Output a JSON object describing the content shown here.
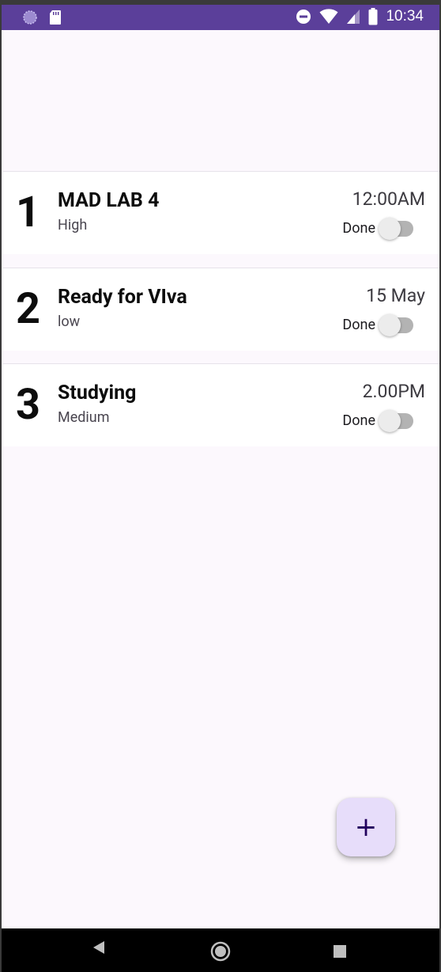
{
  "status_bar": {
    "time": "10:34",
    "background_color": "#5b3f9a",
    "left_icons": [
      "spinner-icon",
      "sd-card-icon"
    ],
    "right_icons": [
      "do-not-disturb-icon",
      "wifi-icon",
      "cell-signal-icon",
      "battery-icon"
    ]
  },
  "tasks": [
    {
      "number": "1",
      "title": "MAD LAB 4",
      "priority": "High",
      "time": "12:00AM",
      "done_label": "Done",
      "done": false
    },
    {
      "number": "2",
      "title": "Ready for VIva",
      "priority": "low",
      "time": "15 May",
      "done_label": "Done",
      "done": false
    },
    {
      "number": "3",
      "title": "Studying",
      "priority": "Medium",
      "time": "2.00PM",
      "done_label": "Done",
      "done": false
    }
  ],
  "fab": {
    "icon": "plus-icon",
    "label": "+",
    "background_color": "#e7ddfa"
  },
  "nav_bar": {
    "icons": [
      "back-icon",
      "home-icon",
      "recents-icon"
    ]
  }
}
